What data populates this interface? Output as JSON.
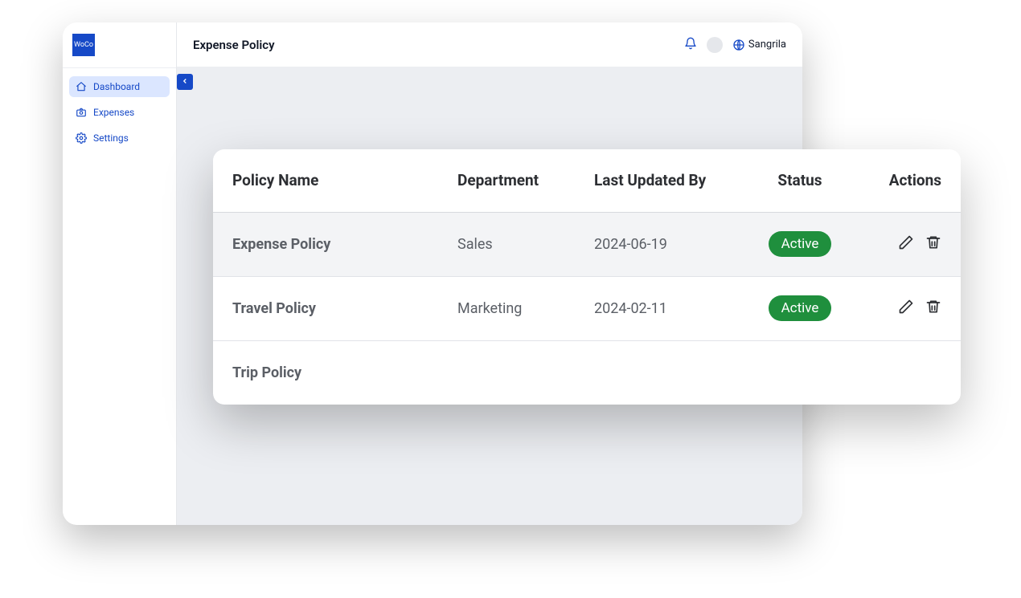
{
  "brand": {
    "logo_text": "WoCo"
  },
  "header": {
    "title": "Expense Policy",
    "user_name": "Sangrila"
  },
  "sidebar": {
    "items": [
      {
        "label": "Dashboard",
        "icon": "home",
        "active": true
      },
      {
        "label": "Expenses",
        "icon": "camera",
        "active": false
      },
      {
        "label": "Settings",
        "icon": "gear",
        "active": false
      }
    ]
  },
  "policy_table": {
    "headers": {
      "name": "Policy Name",
      "dept": "Department",
      "updated": "Last Updated By",
      "status": "Status",
      "actions": "Actions"
    },
    "rows": [
      {
        "name": "Expense Policy",
        "dept": "Sales",
        "updated": "2024-06-19",
        "status": "Active",
        "highlight": true,
        "show_details": true
      },
      {
        "name": "Travel Policy",
        "dept": "Marketing",
        "updated": "2024-02-11",
        "status": "Active",
        "highlight": false,
        "show_details": true
      },
      {
        "name": "Trip Policy",
        "dept": "",
        "updated": "",
        "status": "",
        "highlight": false,
        "show_details": false
      }
    ]
  }
}
